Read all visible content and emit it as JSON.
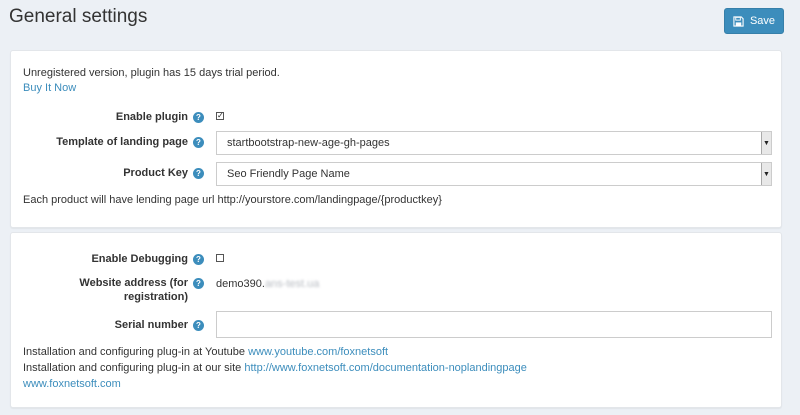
{
  "header": {
    "title": "General settings",
    "save_label": "Save"
  },
  "general": {
    "notice": "Unregistered version, plugin has 15 days trial period.",
    "buy_link": "Buy It Now",
    "enable_plugin_label": "Enable plugin",
    "enable_plugin_checked": true,
    "template_label": "Template of landing page",
    "template_value": "startbootstrap-new-age-gh-pages",
    "product_key_label": "Product Key",
    "product_key_value": "Seo Friendly Page Name",
    "url_note": "Each product will have lending page url http://yourstore.com/landingpage/{productkey}"
  },
  "registration": {
    "debug_label": "Enable Debugging",
    "debug_checked": false,
    "website_label_line1": "Website address (for",
    "website_label_line2": "registration)",
    "website_value": "demo390.",
    "website_value_blurred": "ans-test.ua",
    "serial_label": "Serial number",
    "serial_value": "",
    "youtube_text": "Installation and configuring plug-in at Youtube ",
    "youtube_link": "www.youtube.com/foxnetsoft",
    "site_text": "Installation and configuring plug-in at our site ",
    "site_link": "http://www.foxnetsoft.com/documentation-noplandingpage",
    "home_link": "www.foxnetsoft.com"
  },
  "icons": {
    "save": "floppy-disk-icon",
    "help": "question-circle-icon"
  },
  "colors": {
    "accent": "#3c8dbc",
    "background": "#ecf0f5"
  }
}
